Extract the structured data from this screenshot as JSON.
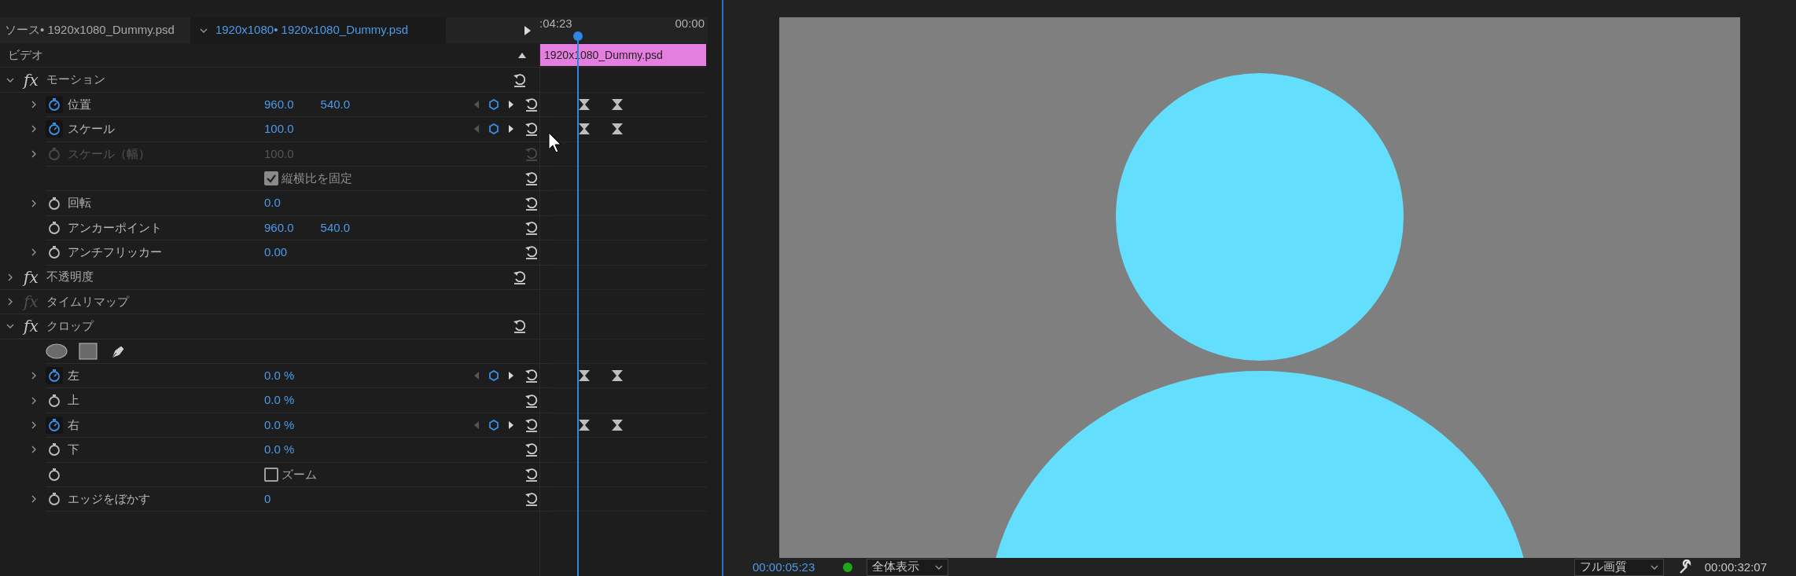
{
  "effect_controls": {
    "tabs": [
      {
        "label": "ソース• 1920x1080_Dummy.psd",
        "selected": false,
        "dropdown": false
      },
      {
        "label": "1920x1080• 1920x1080_Dummy.psd",
        "selected": true,
        "dropdown": true
      }
    ],
    "ruler": [
      ":04:23",
      "00:00"
    ],
    "clip": {
      "label": "1920x1080_Dummy.psd",
      "color": "#e47fe0"
    },
    "section": "ビデオ",
    "effects": [
      {
        "name": "モーション",
        "fx": "fx",
        "enabled": true,
        "expanded": true,
        "reset": true,
        "rows": [
          {
            "kind": "property",
            "label": "位置",
            "values": [
              "960.0",
              "540.0"
            ],
            "expandable": true,
            "animated": true,
            "disabled": false,
            "keyframes": true
          },
          {
            "kind": "property",
            "label": "スケール",
            "values": [
              "100.0"
            ],
            "expandable": true,
            "animated": true,
            "disabled": false,
            "keyframes": true
          },
          {
            "kind": "property",
            "label": "スケール（幅）",
            "values": [
              "100.0"
            ],
            "expandable": true,
            "animated": false,
            "disabled": true,
            "keyframes": false
          },
          {
            "kind": "checkbox",
            "label": "縦横比を固定",
            "checked": true,
            "disabled": true,
            "stopwatch": false
          },
          {
            "kind": "property",
            "label": "回転",
            "values": [
              "0.0"
            ],
            "expandable": true,
            "animated": false,
            "disabled": false,
            "keyframes": false
          },
          {
            "kind": "property",
            "label": "アンカーポイント",
            "values": [
              "960.0",
              "540.0"
            ],
            "expandable": false,
            "animated": false,
            "disabled": false,
            "keyframes": false
          },
          {
            "kind": "property",
            "label": "アンチフリッカー",
            "values": [
              "0.00"
            ],
            "expandable": true,
            "animated": false,
            "disabled": false,
            "keyframes": false
          }
        ]
      },
      {
        "name": "不透明度",
        "fx": "fx",
        "enabled": true,
        "expanded": false,
        "reset": true
      },
      {
        "name": "タイムリマップ",
        "fx": "fx",
        "enabled": false,
        "expanded": false,
        "reset": false
      },
      {
        "name": "クロップ",
        "fx": "fx",
        "enabled": true,
        "expanded": true,
        "reset": true,
        "rows": [
          {
            "kind": "mask_tools"
          },
          {
            "kind": "property",
            "label": "左",
            "values": [
              "0.0 %"
            ],
            "expandable": true,
            "animated": true,
            "disabled": false,
            "keyframes": true
          },
          {
            "kind": "property",
            "label": "上",
            "values": [
              "0.0 %"
            ],
            "expandable": true,
            "animated": false,
            "disabled": false,
            "keyframes": false
          },
          {
            "kind": "property",
            "label": "右",
            "values": [
              "0.0 %"
            ],
            "expandable": true,
            "animated": true,
            "disabled": false,
            "keyframes": true
          },
          {
            "kind": "property",
            "label": "下",
            "values": [
              "0.0 %"
            ],
            "expandable": true,
            "animated": false,
            "disabled": false,
            "keyframes": false
          },
          {
            "kind": "checkbox",
            "label": "ズーム",
            "checked": false,
            "disabled": false,
            "stopwatch": true
          },
          {
            "kind": "property",
            "label": "エッジをぼかす",
            "values": [
              "0"
            ],
            "expandable": true,
            "animated": false,
            "disabled": false,
            "keyframes": false
          }
        ]
      }
    ]
  },
  "program_monitor": {
    "timecode": "00:00:05:23",
    "zoom": "全体表示",
    "quality": "フル画質",
    "duration": "00:00:32:07"
  }
}
